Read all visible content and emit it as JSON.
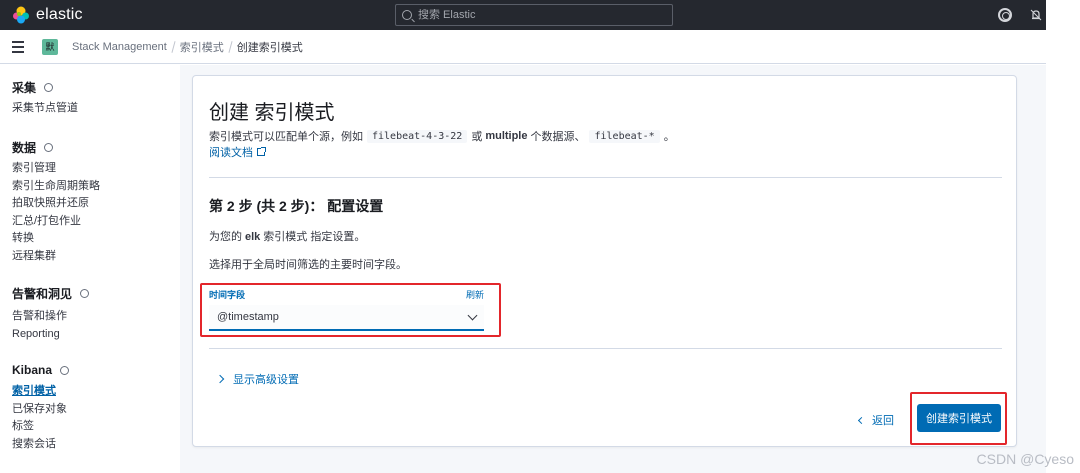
{
  "header": {
    "brand": "elastic",
    "search_placeholder": "搜索 Elastic"
  },
  "breadcrumb": {
    "space_initial": "默",
    "items": [
      "Stack Management",
      "索引模式",
      "创建索引模式"
    ]
  },
  "sidebar": {
    "groups": [
      {
        "title": "采集",
        "items": [
          "采集节点管道"
        ]
      },
      {
        "title": "数据",
        "items": [
          "索引管理",
          "索引生命周期策略",
          "拍取快照并还原",
          "汇总/打包作业",
          "转换",
          "远程集群"
        ]
      },
      {
        "title": "告警和洞见",
        "items": [
          "告警和操作",
          "Reporting"
        ]
      },
      {
        "title": "Kibana",
        "items": [
          "索引模式",
          "已保存对象",
          "标签",
          "搜索会话"
        ],
        "active": "索引模式"
      }
    ]
  },
  "main": {
    "title": "创建 索引模式",
    "desc": {
      "prefix": "索引模式可以匹配单个源，例如",
      "code1": "filebeat-4-3-22",
      "or": "或",
      "bold": "multiple",
      "middle": "个数据源、",
      "code2": "filebeat-*",
      "suffix": "。"
    },
    "docs_link": "阅读文档",
    "step_title": "第 2 步 (共 2 步)： 配置设置",
    "step_desc": {
      "prefix": "为您的",
      "name": "elk",
      "suffix": "索引模式 指定设置。"
    },
    "step_hint": "选择用于全局时间筛选的主要时间字段。",
    "time_field": {
      "label": "时间字段",
      "refresh": "刷新",
      "value": "@timestamp"
    },
    "advanced_settings": "显示高级设置",
    "back_label": "返回",
    "create_label": "创建索引模式"
  },
  "watermark": "CSDN @Cyeso",
  "colors": {
    "accent": "#006bb4",
    "header_bg": "#25282f",
    "highlight": "#e3262b"
  }
}
